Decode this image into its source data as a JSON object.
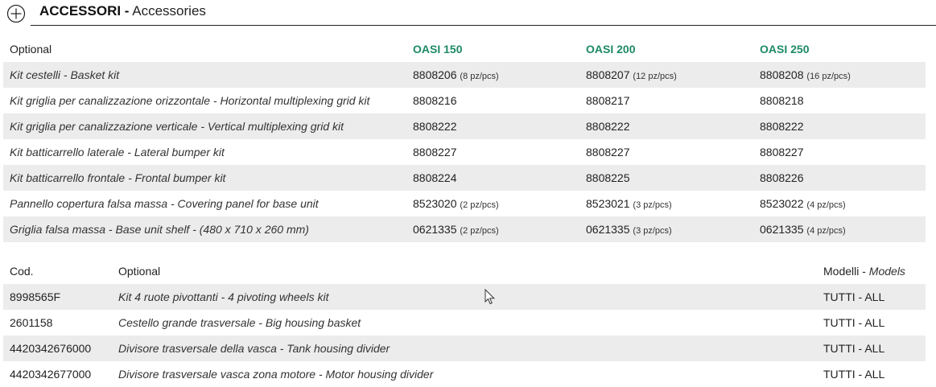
{
  "header": {
    "title_bold": "ACCESSORI -",
    "title_light": "Accessories"
  },
  "table1": {
    "headers": [
      "Optional",
      "OASI 150",
      "OASI 200",
      "OASI 250"
    ],
    "accent_color": "#1d8a63",
    "rows": [
      {
        "name": "Kit cestelli - Basket kit",
        "cells": [
          {
            "code": "8808206",
            "note": "(8 pz/pcs)"
          },
          {
            "code": "8808207",
            "note": "(12 pz/pcs)"
          },
          {
            "code": "8808208",
            "note": "(16 pz/pcs)"
          }
        ]
      },
      {
        "name": "Kit griglia per canalizzazione orizzontale - Horizontal multiplexing grid kit",
        "cells": [
          {
            "code": "8808216",
            "note": ""
          },
          {
            "code": "8808217",
            "note": ""
          },
          {
            "code": "8808218",
            "note": ""
          }
        ]
      },
      {
        "name": "Kit griglia per canalizzazione verticale - Vertical multiplexing grid kit",
        "cells": [
          {
            "code": "8808222",
            "note": ""
          },
          {
            "code": "8808222",
            "note": ""
          },
          {
            "code": "8808222",
            "note": ""
          }
        ]
      },
      {
        "name": "Kit batticarrello laterale - Lateral bumper kit",
        "cells": [
          {
            "code": "8808227",
            "note": ""
          },
          {
            "code": "8808227",
            "note": ""
          },
          {
            "code": "8808227",
            "note": ""
          }
        ]
      },
      {
        "name": "Kit batticarrello frontale - Frontal bumper kit",
        "cells": [
          {
            "code": "8808224",
            "note": ""
          },
          {
            "code": "8808225",
            "note": ""
          },
          {
            "code": "8808226",
            "note": ""
          }
        ]
      },
      {
        "name": "Pannello copertura falsa massa - Covering panel for base unit",
        "cells": [
          {
            "code": "8523020",
            "note": "(2 pz/pcs)"
          },
          {
            "code": "8523021",
            "note": "(3 pz/pcs)"
          },
          {
            "code": "8523022",
            "note": "(4 pz/pcs)"
          }
        ]
      },
      {
        "name": "Griglia falsa massa - Base unit shelf - (480 x 710 x 260 mm)",
        "cells": [
          {
            "code": "0621335",
            "note": "(2 pz/pcs)"
          },
          {
            "code": "0621335",
            "note": "(3 pz/pcs)"
          },
          {
            "code": "0621335",
            "note": "(4 pz/pcs)"
          }
        ]
      }
    ]
  },
  "table2": {
    "headers": {
      "cod": "Cod.",
      "optional": "Optional",
      "models": "Modelli -",
      "models_en": "Models"
    },
    "rows": [
      {
        "cod": "8998565F",
        "name": "Kit 4 ruote pivottanti - 4 pivoting wheels kit",
        "models": "TUTTI - ALL"
      },
      {
        "cod": "2601158",
        "name": "Cestello grande trasversale - Big housing basket",
        "models": "TUTTI - ALL"
      },
      {
        "cod": "4420342676000",
        "name": "Divisore trasversale della vasca - Tank housing divider",
        "models": "TUTTI - ALL"
      },
      {
        "cod": "4420342677000",
        "name": "Divisore trasversale vasca zona motore - Motor housing divider",
        "models": "TUTTI - ALL"
      }
    ]
  }
}
